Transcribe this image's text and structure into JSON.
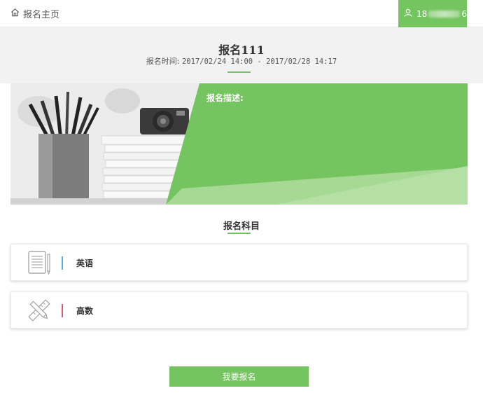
{
  "topbar": {
    "home_label": "报名主页",
    "user_prefix": "18",
    "user_suffix": "6"
  },
  "header": {
    "title": "报名111",
    "time_label": "报名时间:",
    "time_range": "2017/02/24 14:00 - 2017/02/28 14:17"
  },
  "banner": {
    "description_label": "报名描述:"
  },
  "subjects": {
    "section_title": "报名科目",
    "items": [
      {
        "name": "英语",
        "icon": "notebook-icon",
        "accent": "#5aa9e6"
      },
      {
        "name": "高数",
        "icon": "ruler-pencil-icon",
        "accent": "#e0566f"
      }
    ]
  },
  "actions": {
    "submit_label": "我要报名"
  },
  "colors": {
    "brand_green": "#74c45f",
    "header_bg": "#f2f2f2"
  }
}
